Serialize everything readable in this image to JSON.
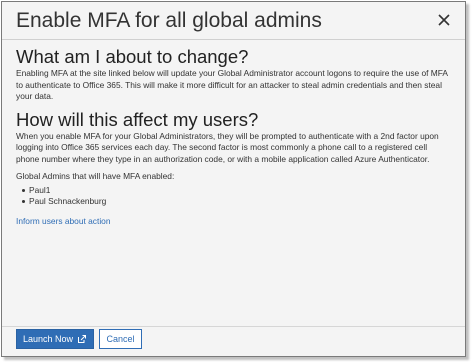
{
  "dialog": {
    "title": "Enable MFA for all global admins"
  },
  "sections": [
    {
      "heading": "What am I about to change?",
      "text": "Enabling MFA at the site linked below will update your Global Administrator account logons to require the use of MFA to authenticate to Office 365. This will make it more difficult for an attacker to steal admin credentials and then steal your data."
    },
    {
      "heading": "How will this affect my users?",
      "text": "When you enable MFA for your Global Administrators, they will be prompted to authenticate with a 2nd factor upon logging into Office 365 services each day. The second factor is most commonly a phone call to a registered cell phone number where they type in an authorization code, or with a mobile application called Azure Authenticator."
    }
  ],
  "admins": {
    "label": "Global Admins that will have MFA enabled:",
    "items": [
      "Paul1",
      "Paul Schnackenburg"
    ]
  },
  "inform_link": "Inform users about action",
  "footer": {
    "launch_label": "Launch Now",
    "cancel_label": "Cancel"
  },
  "colors": {
    "accent": "#2f6db5",
    "background": "#f4f4f4"
  }
}
